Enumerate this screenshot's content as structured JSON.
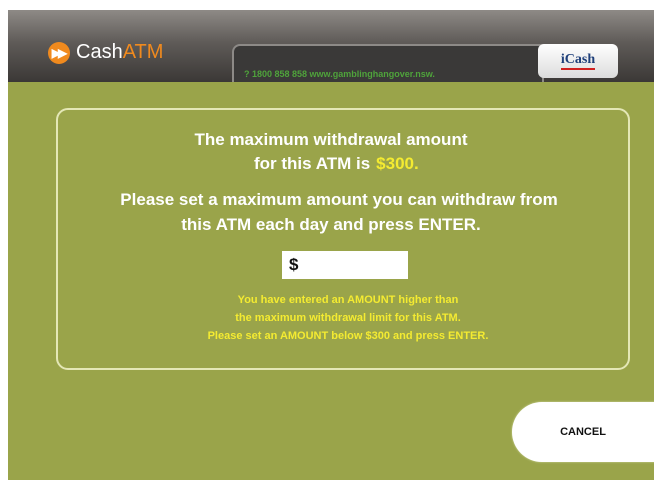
{
  "header": {
    "brand_cash": "Cash",
    "brand_atm": "ATM",
    "ticker": "? 1800 858 858  www.gamblinghangover.nsw.",
    "icash_label": "iCash"
  },
  "message": {
    "line1": "The maximum withdrawal amount",
    "line2": "for this ATM is",
    "max_amount": "$300.",
    "line3": "Please set a maximum amount you can withdraw from",
    "line4": "this ATM each day and press ENTER."
  },
  "amount_input": {
    "currency_symbol": "$",
    "value": ""
  },
  "error": {
    "line1": "You have entered an AMOUNT higher than",
    "line2": "the maximum withdrawal limit for this ATM.",
    "line3": "Please set an AMOUNT below $300 and press ENTER."
  },
  "actions": {
    "cancel_label": "CANCEL"
  },
  "colors": {
    "background": "#9aa44a",
    "accent": "#f08a1e",
    "highlight": "#f4eb31"
  }
}
